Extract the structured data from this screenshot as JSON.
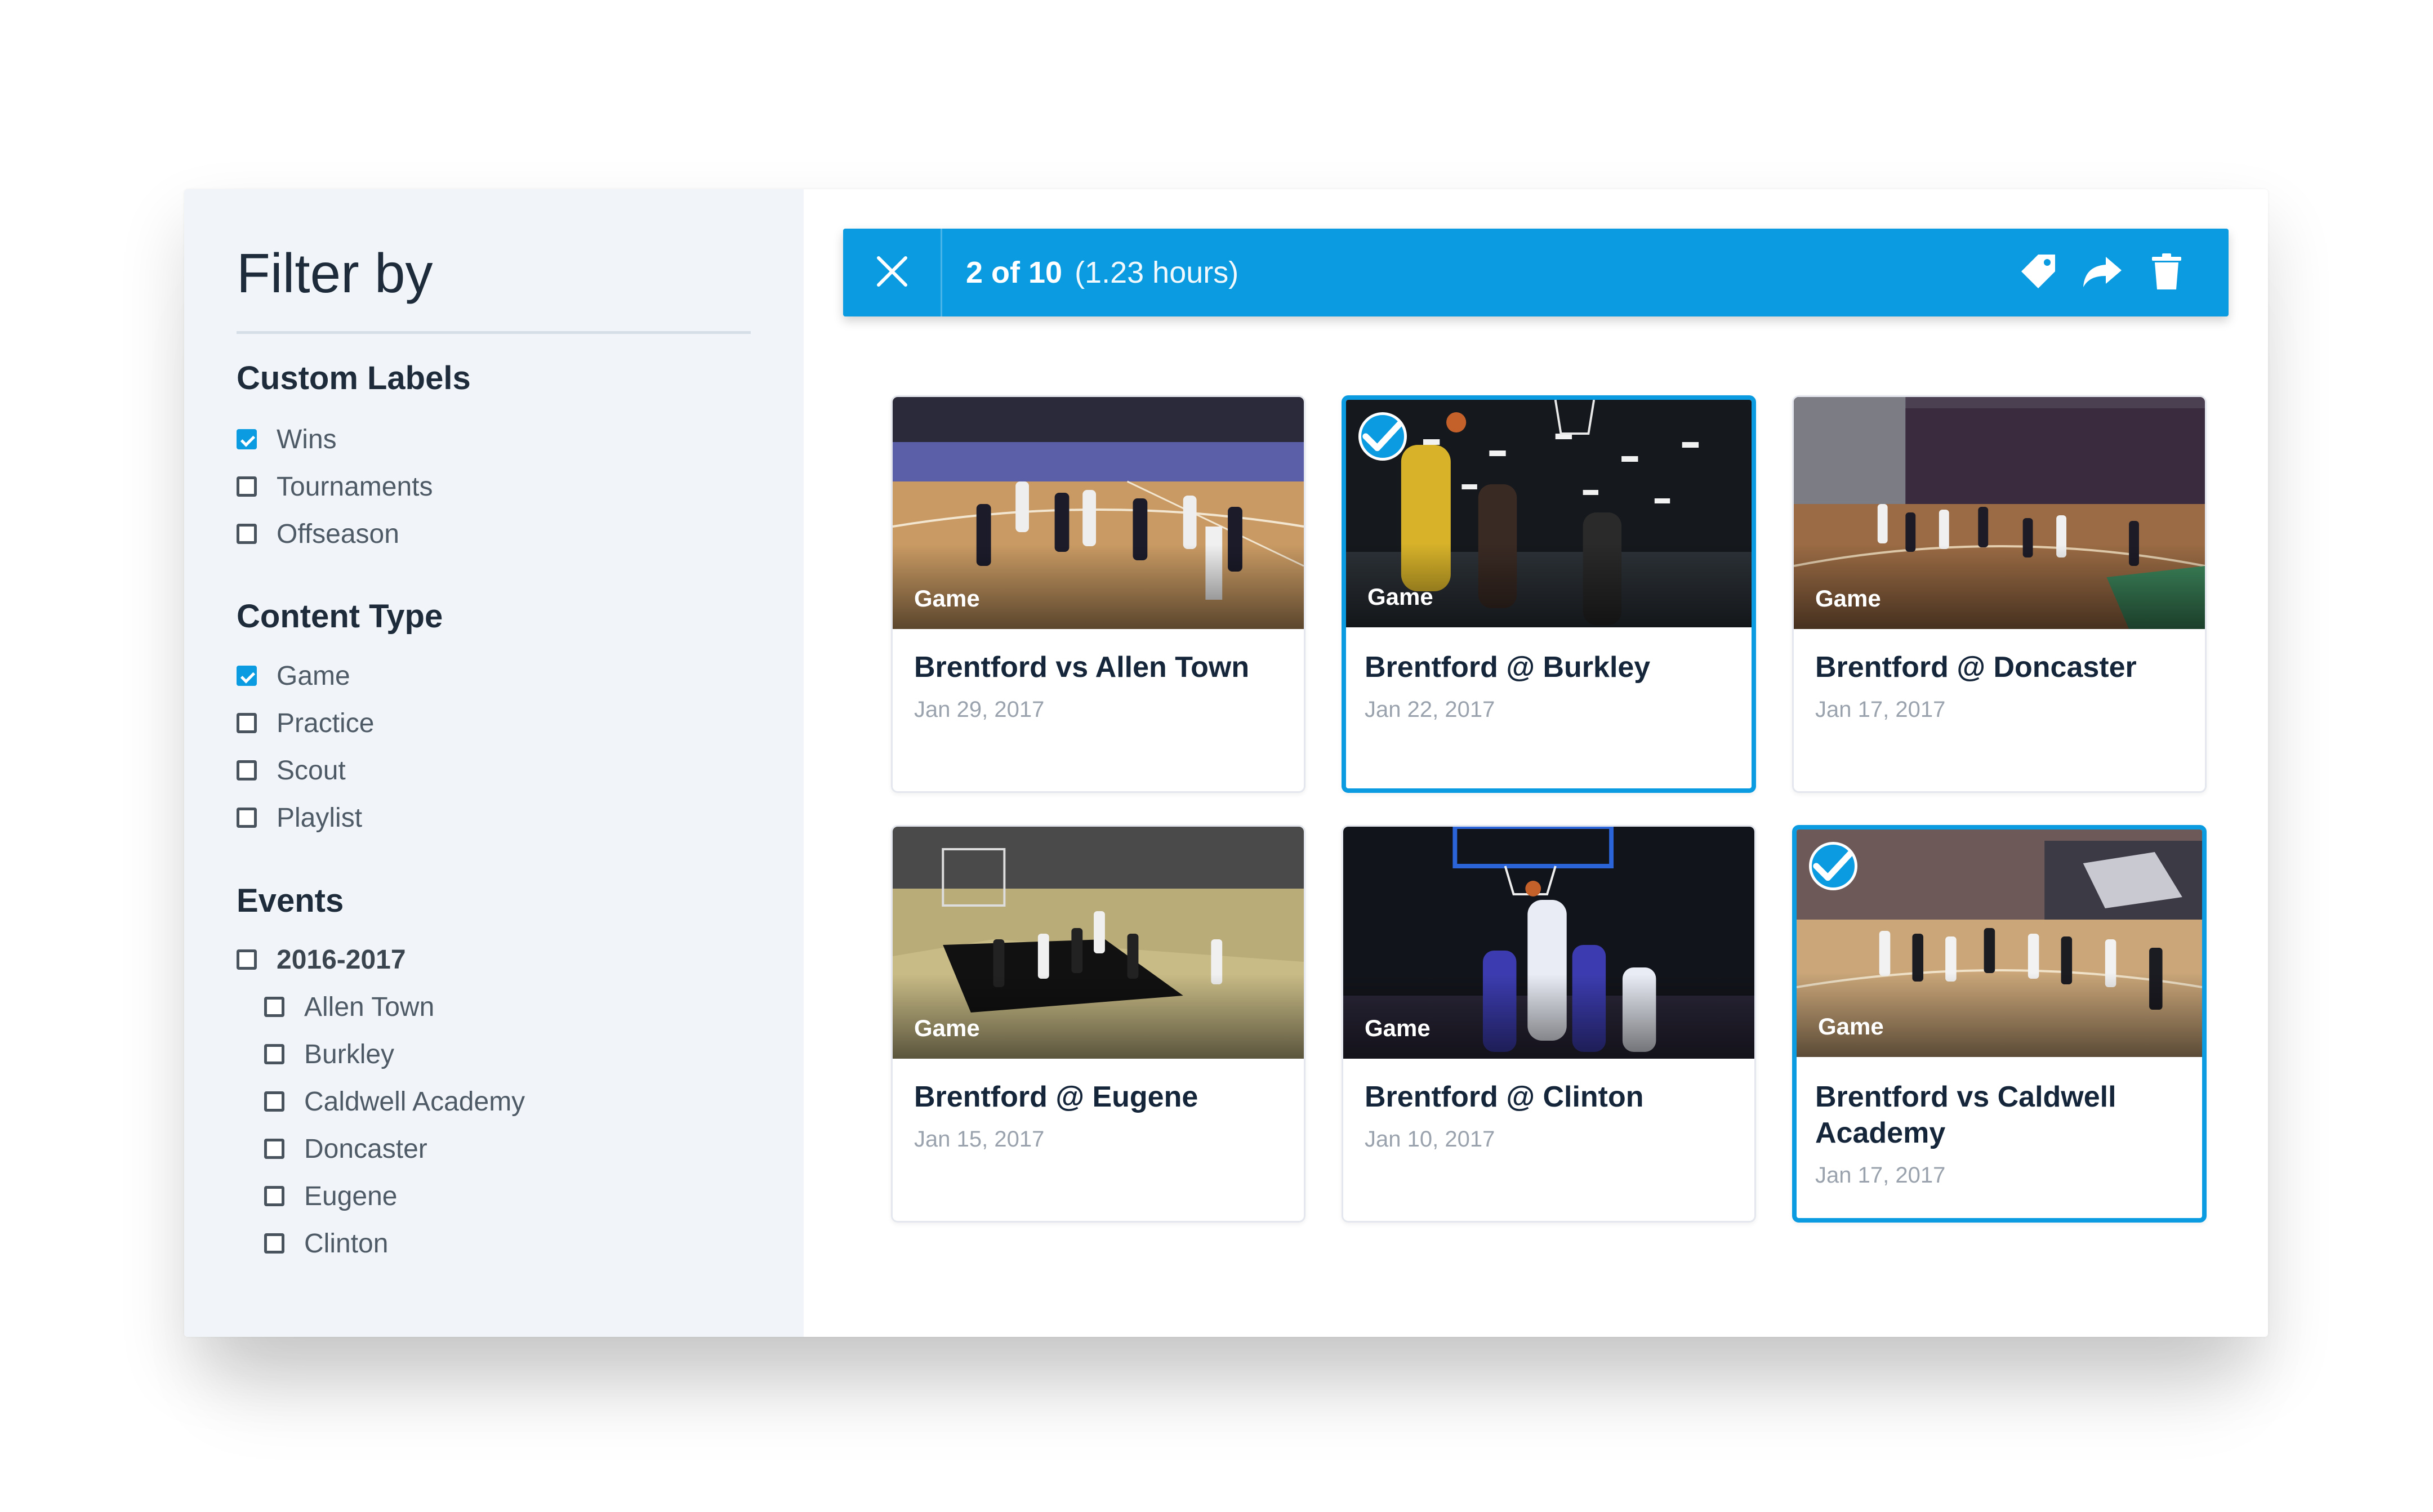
{
  "filters": {
    "title": "Filter by",
    "custom_labels": {
      "heading": "Custom Labels",
      "items": [
        {
          "label": "Wins",
          "checked": true
        },
        {
          "label": "Tournaments",
          "checked": false
        },
        {
          "label": "Offseason",
          "checked": false
        }
      ]
    },
    "content_type": {
      "heading": "Content Type",
      "items": [
        {
          "label": "Game",
          "checked": true
        },
        {
          "label": "Practice",
          "checked": false
        },
        {
          "label": "Scout",
          "checked": false
        },
        {
          "label": "Playlist",
          "checked": false
        }
      ]
    },
    "events": {
      "heading": "Events",
      "season": {
        "label": "2016-2017",
        "checked": false
      },
      "items": [
        {
          "label": "Allen Town",
          "checked": false
        },
        {
          "label": "Burkley",
          "checked": false
        },
        {
          "label": "Caldwell Academy",
          "checked": false
        },
        {
          "label": "Doncaster",
          "checked": false
        },
        {
          "label": "Eugene",
          "checked": false
        },
        {
          "label": "Clinton",
          "checked": false
        }
      ]
    }
  },
  "selection_bar": {
    "count": "2 of 10",
    "duration": "(1.23 hours)",
    "icons": [
      "close-icon",
      "tag-icon",
      "share-icon",
      "trash-icon"
    ]
  },
  "videos": [
    {
      "type": "Game",
      "title": "Brentford vs Allen Town",
      "date": "Jan 29, 2017",
      "selected": false
    },
    {
      "type": "Game",
      "title": "Brentford @ Burkley",
      "date": "Jan 22, 2017",
      "selected": true
    },
    {
      "type": "Game",
      "title": "Brentford @ Doncaster",
      "date": "Jan 17, 2017",
      "selected": false
    },
    {
      "type": "Game",
      "title": "Brentford @ Eugene",
      "date": "Jan 15, 2017",
      "selected": false
    },
    {
      "type": "Game",
      "title": "Brentford @ Clinton",
      "date": "Jan 10, 2017",
      "selected": false
    },
    {
      "type": "Game",
      "title": "Brentford vs Caldwell Academy",
      "date": "Jan 17, 2017",
      "selected": true
    }
  ],
  "colors": {
    "accent": "#0b9be0",
    "sidebar_bg": "#f1f4f8",
    "title_text": "#15253a",
    "date_text": "#9aa3ad"
  }
}
